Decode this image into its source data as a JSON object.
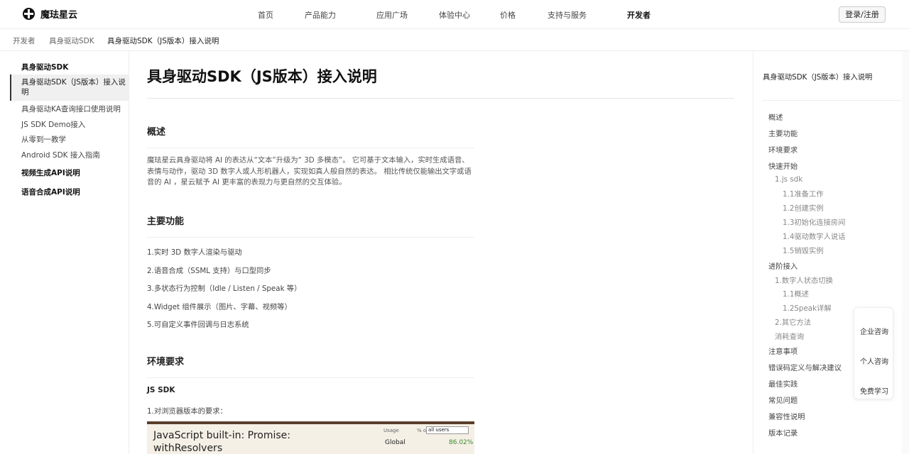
{
  "brand": {
    "name": "魔珐星云",
    "logo_icon": "compass-logo-icon"
  },
  "nav": {
    "items": [
      "首页",
      "产品能力",
      "应用广场",
      "体验中心",
      "价格",
      "支持与服务",
      "开发者"
    ],
    "active": "开发者",
    "login_label": "登录/注册"
  },
  "breadcrumb": [
    "开发者",
    "具身驱动SDK",
    "具身驱动SDK（JS版本）接入说明"
  ],
  "sidebar": {
    "group1": "具身驱动SDK",
    "active_item": "具身驱动SDK（JS版本）接入说明",
    "items": [
      "具身驱动KA查询接口使用说明",
      "JS SDK Demo接入",
      "从零到一教学",
      "Android SDK 接入指南"
    ],
    "group2": "视频生成API说明",
    "group3": "语音合成API说明"
  },
  "main": {
    "title": "具身驱动SDK（JS版本）接入说明",
    "overview_heading": "概述",
    "overview_text": "魔珐星云具身驱动将 AI 的表达从“文本”升级为“ 3D 多模态”。 它可基于文本输入，实时生成语音、表情与动作，驱动 3D 数字人或人形机器人，实现如真人般自然的表达。 相比传统仅能输出文字或语音的 AI ，星云赋予 AI 更丰富的表现力与更自然的交互体验。",
    "features_heading": "主要功能",
    "features": [
      "1.实时 3D 数字人渲染与驱动",
      "2.语音合成（SSML 支持）与口型同步",
      "3.多状态行为控制（Idle / Listen / Speak 等）",
      "4.Widget 组件展示（图片、字幕、视频等）",
      "5.可自定义事件回调与日志系统"
    ],
    "env_heading": "环境要求",
    "js_sdk_heading": "JS SDK",
    "browser_req": "1.对浏览器版本的要求：",
    "embed": {
      "title": "JavaScript built-in: Promise: withResolvers",
      "usage_label": "Usage",
      "pct_label": "% of",
      "select_value": "all users",
      "global_label": "Global",
      "global_value": "86.02%"
    }
  },
  "toc": {
    "title": "具身驱动SDK（JS版本）接入说明",
    "items": [
      "概述",
      "主要功能",
      "环境要求",
      "快速开始",
      "1.js sdk",
      "1.1准备工作",
      "1.2创建实例",
      "1.3初始化连接房间",
      "1.4驱动数字人说话",
      "1.5销毁实例",
      "进阶接入",
      "1.数字人状态切换",
      "1.1概述",
      "1.2Speak详解",
      "2.其它方法",
      "消耗查询",
      "注意事项",
      "错误码定义与解决建议",
      "最佳实践",
      "常见问题",
      "兼容性说明",
      "版本记录"
    ]
  },
  "float_panel": [
    "企业咨询",
    "个人咨询",
    "免费学习"
  ]
}
